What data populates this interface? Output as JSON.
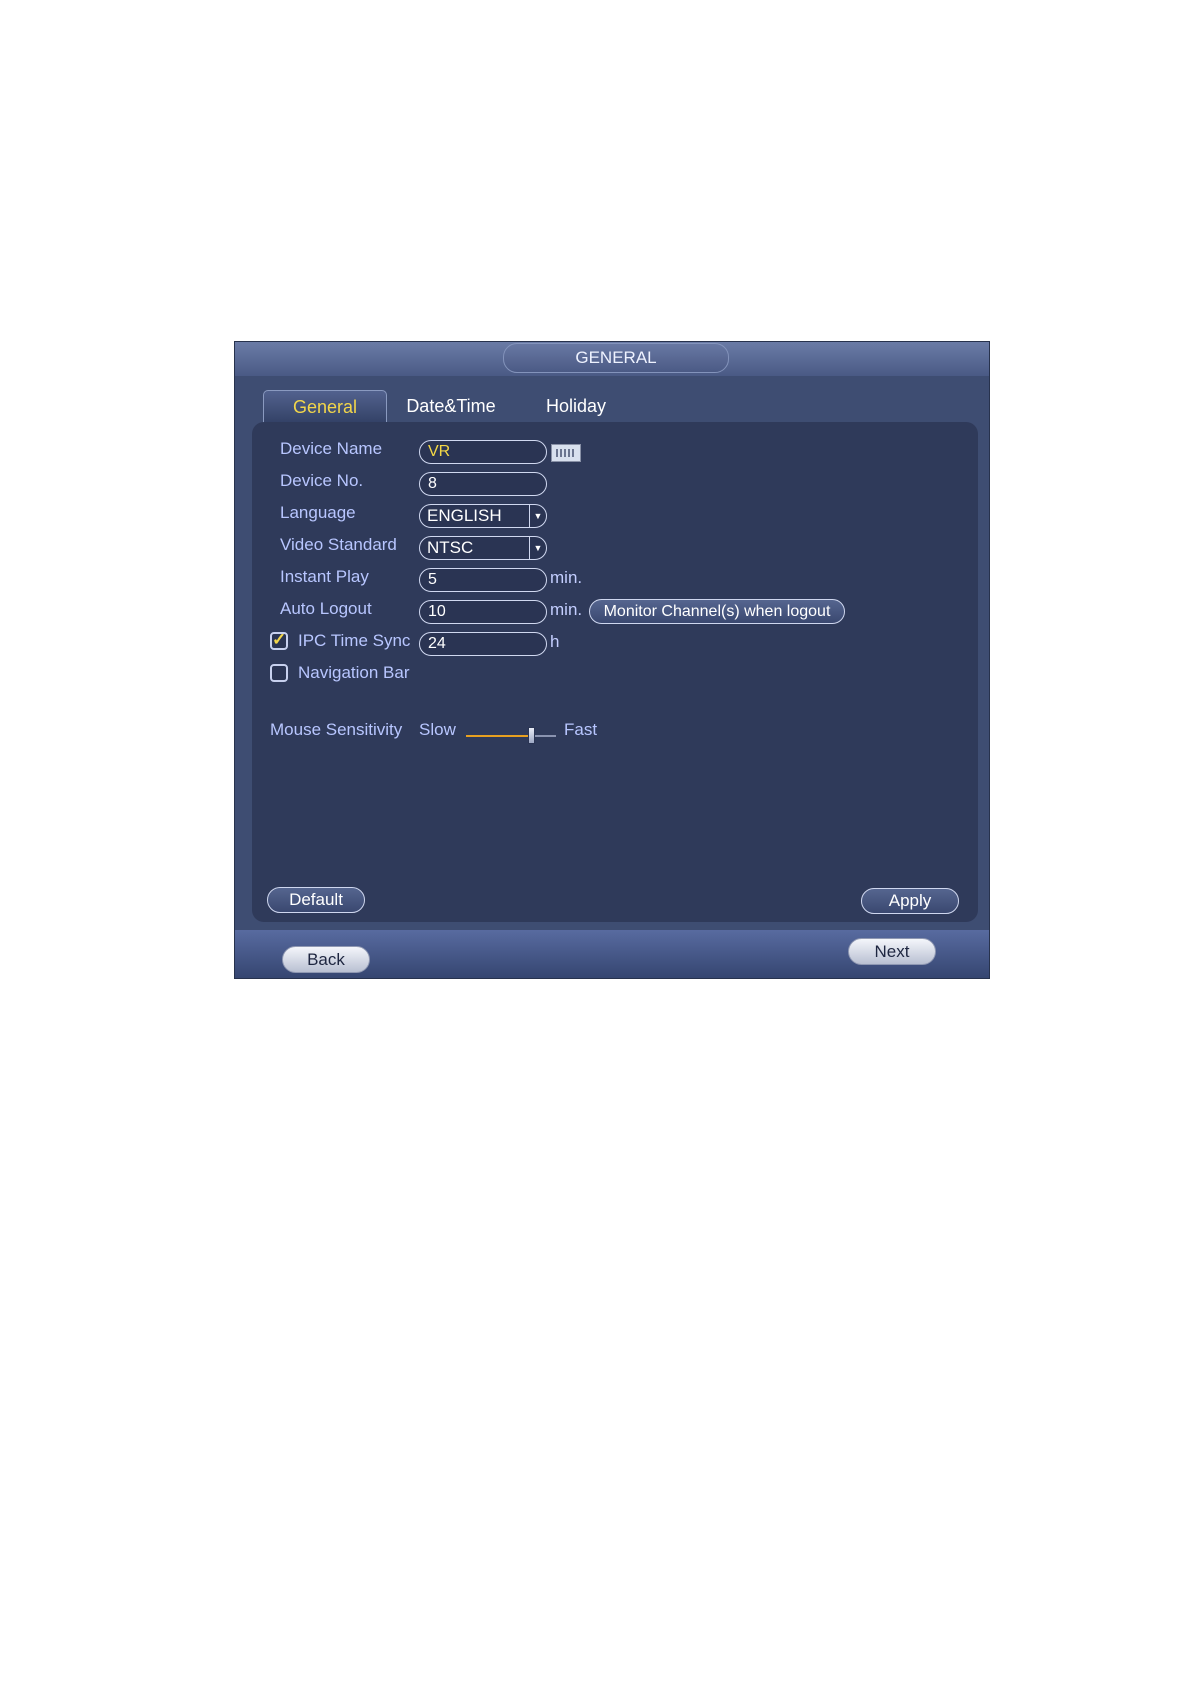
{
  "window": {
    "title": "GENERAL"
  },
  "tabs": [
    {
      "label": "General",
      "active": true
    },
    {
      "label": "Date&Time",
      "active": false
    },
    {
      "label": "Holiday",
      "active": false
    }
  ],
  "form": {
    "device_name": {
      "label": "Device Name",
      "value": "VR"
    },
    "device_no": {
      "label": "Device No.",
      "value": "8"
    },
    "language": {
      "label": "Language",
      "value": "ENGLISH"
    },
    "video_standard": {
      "label": "Video Standard",
      "value": "NTSC"
    },
    "instant_play": {
      "label": "Instant Play",
      "value": "5",
      "unit": "min."
    },
    "auto_logout": {
      "label": "Auto Logout",
      "value": "10",
      "unit": "min.",
      "monitor_button": "Monitor Channel(s) when logout"
    },
    "ipc_time_sync": {
      "label": "IPC Time Sync",
      "checked": true,
      "value": "24",
      "unit": "h"
    },
    "navigation_bar": {
      "label": "Navigation Bar",
      "checked": false
    },
    "mouse_sensitivity": {
      "label": "Mouse Sensitivity",
      "min_label": "Slow",
      "max_label": "Fast",
      "level": 0.72
    }
  },
  "buttons": {
    "default": "Default",
    "apply": "Apply",
    "back": "Back",
    "next": "Next"
  },
  "colors": {
    "active_tab_text": "#f2d64a",
    "label_text": "#b8c6ff",
    "slider_fill": "#e8a020"
  }
}
